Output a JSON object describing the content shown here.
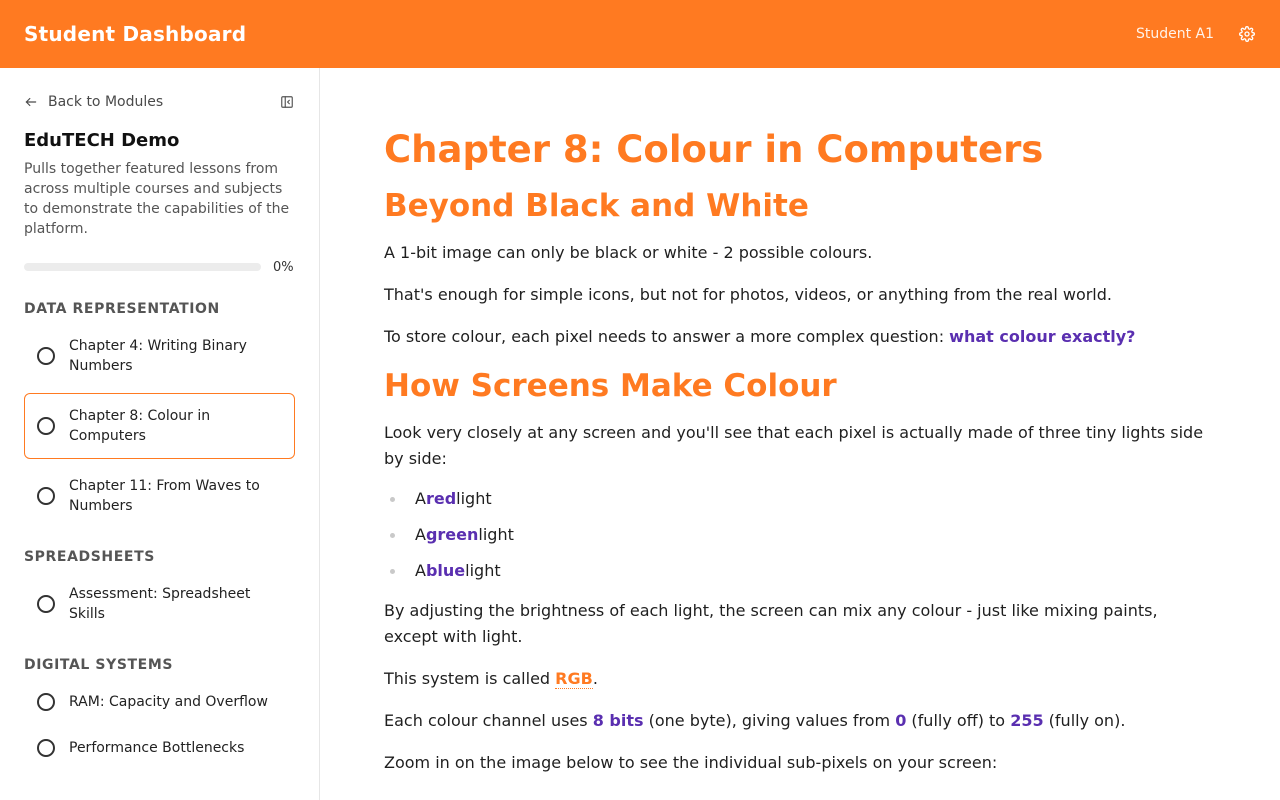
{
  "header": {
    "app_title": "Student Dashboard",
    "user_name": "Student A1",
    "settings_icon": "gear-icon"
  },
  "sidebar": {
    "back_label": "Back to Modules",
    "course_title": "EduTECH Demo",
    "course_description": "Pulls together featured lessons from across multiple courses and subjects to demonstrate the capabilities of the platform.",
    "progress_percent": 0,
    "progress_label": "0%",
    "sections": [
      {
        "title": "DATA REPRESENTATION",
        "lessons": [
          {
            "label": "Chapter 4: Writing Binary Numbers",
            "active": false
          },
          {
            "label": "Chapter 8: Colour in Computers",
            "active": true
          },
          {
            "label": "Chapter 11: From Waves to Numbers",
            "active": false
          }
        ]
      },
      {
        "title": "SPREADSHEETS",
        "lessons": [
          {
            "label": "Assessment: Spreadsheet Skills",
            "active": false
          }
        ]
      },
      {
        "title": "DIGITAL SYSTEMS",
        "lessons": [
          {
            "label": "RAM: Capacity and Overflow",
            "active": false
          },
          {
            "label": "Performance Bottlenecks",
            "active": false
          }
        ]
      }
    ]
  },
  "content": {
    "chapter_title": "Chapter 8: Colour in Computers",
    "h_beyond": "Beyond Black and White",
    "p1": "A 1-bit image can only be black or white - 2 possible colours.",
    "p2": "That's enough for simple icons, but not for photos, videos, or anything from the real world.",
    "p3_pre": "To store colour, each pixel needs to answer a more complex question: ",
    "p3_hl": "what colour exactly?",
    "h_screens": "How Screens Make Colour",
    "p4": "Look very closely at any screen and you'll see that each pixel is actually made of three tiny lights side by side:",
    "lights": [
      {
        "pre": "A ",
        "hl": "red",
        "post": " light"
      },
      {
        "pre": "A ",
        "hl": "green",
        "post": " light"
      },
      {
        "pre": "A ",
        "hl": "blue",
        "post": " light"
      }
    ],
    "p5": "By adjusting the brightness of each light, the screen can mix any colour - just like mixing paints, except with light.",
    "p6_pre": "This system is called ",
    "p6_hl": "RGB",
    "p6_post": ".",
    "p7_a": "Each colour channel uses ",
    "p7_b": "8 bits",
    "p7_c": " (one byte), giving values from ",
    "p7_d": "0",
    "p7_e": " (fully off) to ",
    "p7_f": "255",
    "p7_g": " (fully on).",
    "p8": "Zoom in on the image below to see the individual sub-pixels on your screen:"
  },
  "colors": {
    "accent": "#ff7a21",
    "highlight": "#5a2fb0"
  }
}
